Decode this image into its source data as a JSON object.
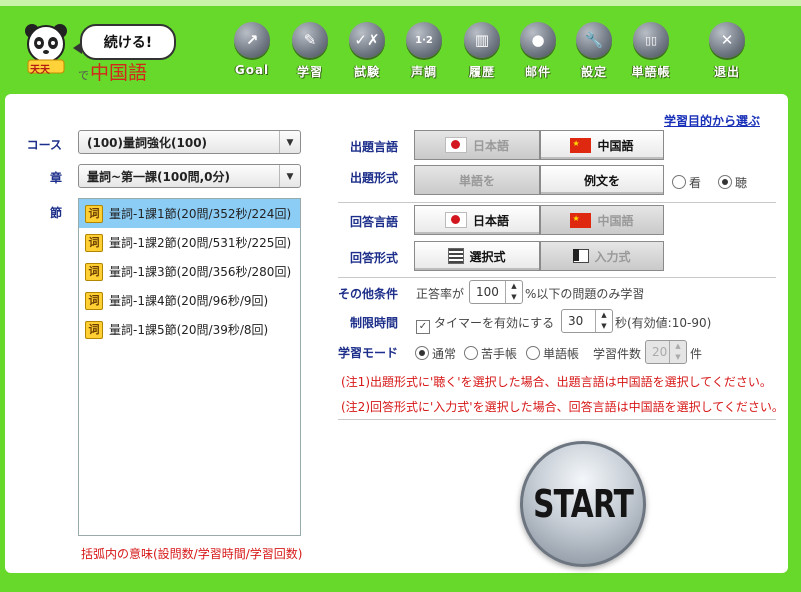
{
  "logo": {
    "bubble": "続ける!",
    "prefix": "で",
    "title": "中国語",
    "badge": "天天"
  },
  "nav": [
    {
      "label": "Goal",
      "icon": "goal-arrow-icon",
      "glyph": "↗"
    },
    {
      "label": "学習",
      "icon": "pencil-icon",
      "glyph": "✎"
    },
    {
      "label": "試験",
      "icon": "check-x-icon",
      "glyph": "✓✗"
    },
    {
      "label": "声調",
      "icon": "tone-numbers-icon",
      "glyph": "1·2"
    },
    {
      "label": "履歴",
      "icon": "bar-chart-icon",
      "glyph": "▥"
    },
    {
      "label": "邮件",
      "icon": "user-silhouette-icon",
      "glyph": "●"
    },
    {
      "label": "設定",
      "icon": "wrench-icon",
      "glyph": "🔧"
    },
    {
      "label": "単語帳",
      "icon": "book-icon",
      "glyph": "▯▯"
    },
    {
      "label": "退出",
      "icon": "close-icon",
      "glyph": "✕"
    }
  ],
  "purpose_link": "学習目的から選ぶ",
  "left": {
    "course_label": "コース",
    "course_value": "(100)量詞強化(100)",
    "chapter_label": "章",
    "chapter_value": "量詞~第一課(100問,0分)",
    "section_label": "節",
    "sections": [
      {
        "text": "量詞-1課1節(20問/352秒/224回)",
        "selected": true
      },
      {
        "text": "量詞-1課2節(20問/531秒/225回)",
        "selected": false
      },
      {
        "text": "量詞-1課3節(20問/356秒/280回)",
        "selected": false
      },
      {
        "text": "量詞-1課4節(20問/96秒/9回)",
        "selected": false
      },
      {
        "text": "量詞-1課5節(20問/39秒/8回)",
        "selected": false
      }
    ],
    "section_icon_char": "词",
    "note": "括弧内の意味(設問数/学習時間/学習回数)"
  },
  "right": {
    "q_lang_label": "出題言語",
    "q_lang_jp": "日本語",
    "q_lang_cn": "中国語",
    "q_format_label": "出題形式",
    "q_format_word": "単語を",
    "q_format_sentence": "例文を",
    "view_label": "看",
    "listen_label": "聴",
    "a_lang_label": "回答言語",
    "a_lang_jp": "日本語",
    "a_lang_cn": "中国語",
    "a_format_label": "回答形式",
    "a_format_choice": "選択式",
    "a_format_input": "入力式",
    "other_label": "その他条件",
    "accuracy_prefix": "正答率が",
    "accuracy_value": "100",
    "accuracy_suffix": "%以下の問題のみ学習",
    "time_label": "制限時間",
    "timer_text": "タイマーを有効にする",
    "timer_value": "30",
    "timer_suffix": "秒(有効値:10-90)",
    "mode_label": "学習モード",
    "mode_normal": "通常",
    "mode_weak": "苦手帳",
    "mode_vocab": "単語帳",
    "count_label": "学習件数",
    "count_value": "20",
    "count_suffix": "件",
    "note1": "(注1)出題形式に'聴く'を選択した場合、出題言語は中国語を選択してください。",
    "note2": "(注2)回答形式に'入力式'を選択した場合、回答言語は中国語を選択してください。"
  },
  "start_label": "START",
  "colors": {
    "background": "#66d92b",
    "accent_blue": "#1d2f8a",
    "warning_red": "#d71818",
    "selected_row": "#8ccdf6"
  }
}
